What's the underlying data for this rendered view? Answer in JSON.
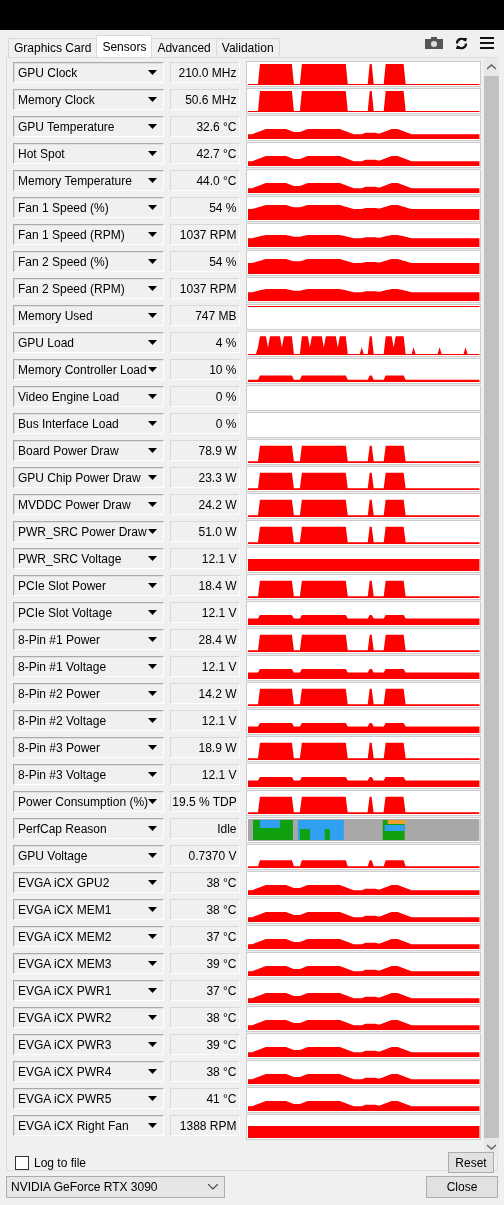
{
  "tabs": [
    {
      "label": "Graphics Card",
      "selected": false
    },
    {
      "label": "Sensors",
      "selected": true
    },
    {
      "label": "Advanced",
      "selected": false
    },
    {
      "label": "Validation",
      "selected": false
    }
  ],
  "sensors": [
    {
      "name": "GPU Clock",
      "value": "210.0 MHz",
      "kind": "clock"
    },
    {
      "name": "Memory Clock",
      "value": "50.6 MHz",
      "kind": "clock"
    },
    {
      "name": "GPU Temperature",
      "value": "32.6 °C",
      "kind": "temp"
    },
    {
      "name": "Hot Spot",
      "value": "42.7 °C",
      "kind": "temp"
    },
    {
      "name": "Memory Temperature",
      "value": "44.0 °C",
      "kind": "temp"
    },
    {
      "name": "Fan 1 Speed (%)",
      "value": "54 %",
      "kind": "fanhi"
    },
    {
      "name": "Fan 1 Speed (RPM)",
      "value": "1037 RPM",
      "kind": "fan"
    },
    {
      "name": "Fan 2 Speed (%)",
      "value": "54 %",
      "kind": "fanhi"
    },
    {
      "name": "Fan 2 Speed (RPM)",
      "value": "1037 RPM",
      "kind": "fan"
    },
    {
      "name": "Memory Used",
      "value": "747 MB",
      "kind": "line"
    },
    {
      "name": "GPU Load",
      "value": "4 %",
      "kind": "load"
    },
    {
      "name": "Memory Controller Load",
      "value": "10 %",
      "kind": "lowload"
    },
    {
      "name": "Video Engine Load",
      "value": "0 %",
      "kind": "empty"
    },
    {
      "name": "Bus Interface Load",
      "value": "0 %",
      "kind": "empty"
    },
    {
      "name": "Board Power Draw",
      "value": "78.9 W",
      "kind": "power"
    },
    {
      "name": "GPU Chip Power Draw",
      "value": "23.3 W",
      "kind": "power"
    },
    {
      "name": "MVDDC Power Draw",
      "value": "24.2 W",
      "kind": "power"
    },
    {
      "name": "PWR_SRC Power Draw",
      "value": "51.0 W",
      "kind": "power"
    },
    {
      "name": "PWR_SRC Voltage",
      "value": "12.1 V",
      "kind": "volt"
    },
    {
      "name": "PCIe Slot Power",
      "value": "18.4 W",
      "kind": "power"
    },
    {
      "name": "PCIe Slot Voltage",
      "value": "12.1 V",
      "kind": "lowvolt"
    },
    {
      "name": "8-Pin #1 Power",
      "value": "28.4 W",
      "kind": "power"
    },
    {
      "name": "8-Pin #1 Voltage",
      "value": "12.1 V",
      "kind": "lowvolt"
    },
    {
      "name": "8-Pin #2 Power",
      "value": "14.2 W",
      "kind": "power"
    },
    {
      "name": "8-Pin #2 Voltage",
      "value": "12.1 V",
      "kind": "lowvolt"
    },
    {
      "name": "8-Pin #3 Power",
      "value": "18.9 W",
      "kind": "power"
    },
    {
      "name": "8-Pin #3 Voltage",
      "value": "12.1 V",
      "kind": "lowvolt"
    },
    {
      "name": "Power Consumption (%)",
      "value": "19.5 % TDP",
      "kind": "power"
    },
    {
      "name": "PerfCap Reason",
      "value": "Idle",
      "kind": "perfcap"
    },
    {
      "name": "GPU Voltage",
      "value": "0.7370 V",
      "kind": "voltage"
    },
    {
      "name": "EVGA iCX GPU2",
      "value": "38 °C",
      "kind": "temp"
    },
    {
      "name": "EVGA iCX MEM1",
      "value": "38 °C",
      "kind": "temp"
    },
    {
      "name": "EVGA iCX MEM2",
      "value": "37 °C",
      "kind": "temp"
    },
    {
      "name": "EVGA iCX MEM3",
      "value": "39 °C",
      "kind": "temp"
    },
    {
      "name": "EVGA iCX PWR1",
      "value": "37 °C",
      "kind": "temp"
    },
    {
      "name": "EVGA iCX PWR2",
      "value": "38 °C",
      "kind": "temp"
    },
    {
      "name": "EVGA iCX PWR3",
      "value": "39 °C",
      "kind": "temp"
    },
    {
      "name": "EVGA iCX PWR4",
      "value": "38 °C",
      "kind": "temp"
    },
    {
      "name": "EVGA iCX PWR5",
      "value": "41 °C",
      "kind": "temp"
    },
    {
      "name": "EVGA iCX Right Fan",
      "value": "1388 RPM",
      "kind": "volt"
    }
  ],
  "log_to_file": {
    "label": "Log to file",
    "checked": false
  },
  "reset_button": "Reset",
  "device": "NVIDIA GeForce RTX 3090",
  "close_button": "Close"
}
